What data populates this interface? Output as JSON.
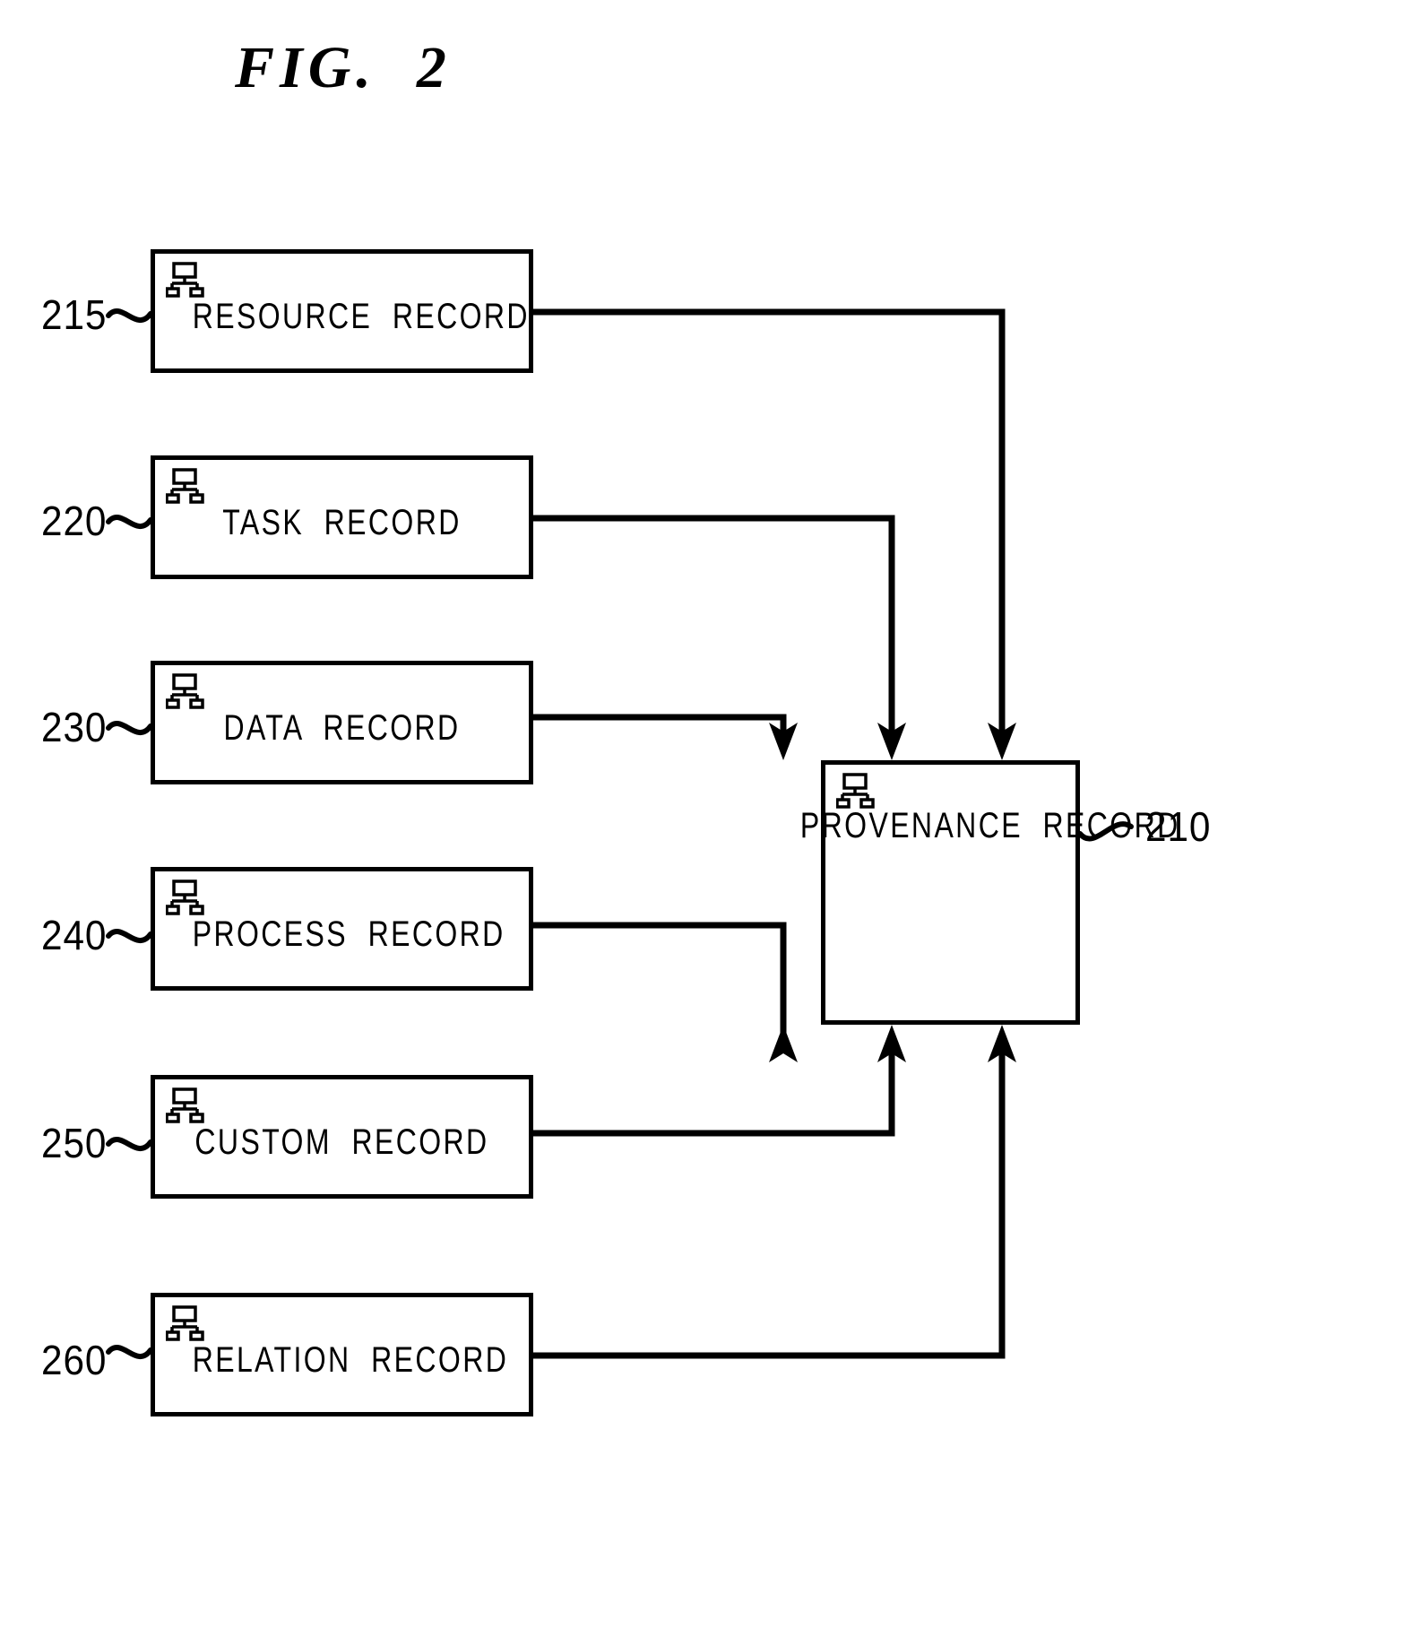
{
  "figure": {
    "title": "FIG.  2",
    "line_color": "#000000",
    "background": "#ffffff"
  },
  "central_node": {
    "ref": "210",
    "label": "PROVENANCE  RECORD",
    "icon": "network-node-icon"
  },
  "source_nodes": [
    {
      "ref": "215",
      "label": "RESOURCE  RECORD",
      "icon": "network-node-icon"
    },
    {
      "ref": "220",
      "label": "TASK  RECORD",
      "icon": "network-node-icon"
    },
    {
      "ref": "230",
      "label": "DATA  RECORD",
      "icon": "network-node-icon"
    },
    {
      "ref": "240",
      "label": "PROCESS  RECORD",
      "icon": "network-node-icon"
    },
    {
      "ref": "250",
      "label": "CUSTOM  RECORD",
      "icon": "network-node-icon"
    },
    {
      "ref": "260",
      "label": "RELATION  RECORD",
      "icon": "network-node-icon"
    }
  ],
  "connections": [
    {
      "from": "215",
      "to": "210",
      "enters": "top"
    },
    {
      "from": "220",
      "to": "210",
      "enters": "top"
    },
    {
      "from": "230",
      "to": "210",
      "enters": "top"
    },
    {
      "from": "240",
      "to": "210",
      "enters": "bottom"
    },
    {
      "from": "250",
      "to": "210",
      "enters": "bottom"
    },
    {
      "from": "260",
      "to": "210",
      "enters": "bottom"
    }
  ]
}
